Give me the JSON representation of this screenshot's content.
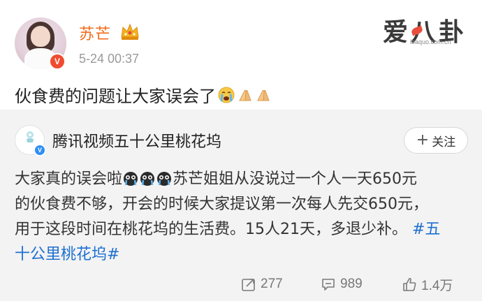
{
  "post": {
    "username": "苏芒",
    "timestamp": "5-24 00:37",
    "text": "伙食费的问题让大家误会了",
    "verified_label": "V"
  },
  "watermark": {
    "title": "爱八卦",
    "url": "ibaquo.com.cn"
  },
  "repost": {
    "author": "腾讯视频五十公里桃花坞",
    "follow_label": "关注",
    "verified_label": "V",
    "body": {
      "line1_a": "大家真的误会啦",
      "line1_b": "苏芒姐姐从没说过一个人一天650元",
      "line2": "的伙食费不够，开会的时候大家提议第一次每人先交650元，",
      "line3_a": "用于这段时间在桃花坞的生活费。15人21天，多退少补。",
      "line3_tag": "#五",
      "line4_tag": "十公里桃花坞#"
    }
  },
  "actions": {
    "repost_count": "277",
    "comment_count": "989",
    "like_count": "1.4万"
  },
  "colors": {
    "username": "#f26b1b",
    "hashtag": "#1d6fd1",
    "repost_bg": "#f3f3f3",
    "verified_red": "#f04c2f",
    "verified_blue": "#2f8ef5"
  },
  "icons": [
    "crown-icon",
    "crying-face-icon",
    "praying-hands-icon",
    "sob-face-icon",
    "repost-icon",
    "comment-icon",
    "like-icon"
  ]
}
